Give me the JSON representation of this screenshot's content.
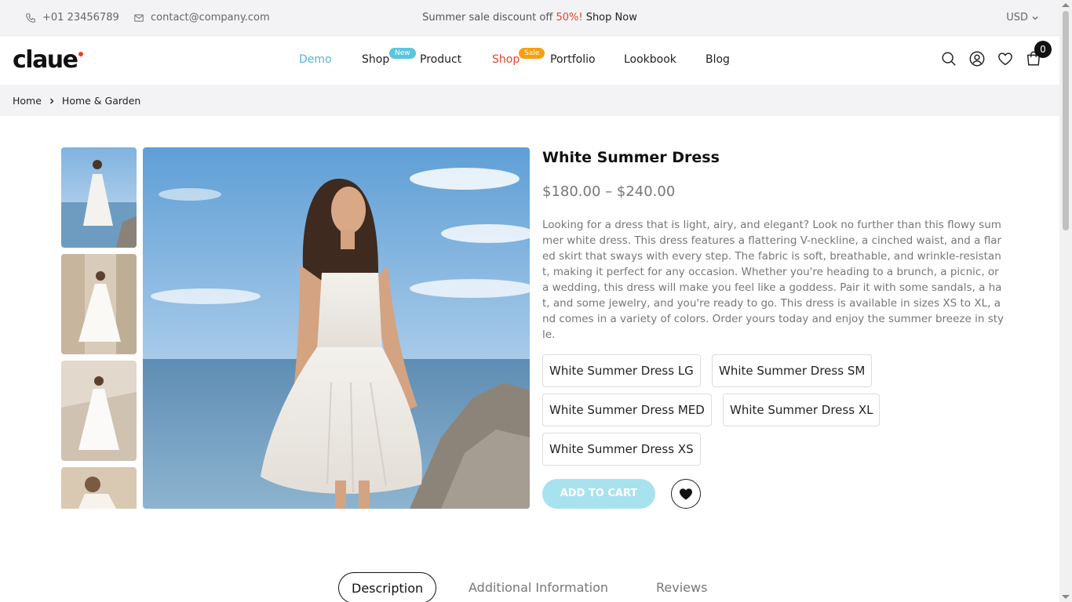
{
  "topbar": {
    "phone": "+01 23456789",
    "email": "contact@company.com",
    "promo_text": "Summer sale discount off ",
    "promo_pct": "50%!",
    "promo_cta": "Shop Now",
    "currency": "USD"
  },
  "header": {
    "logo": "claue",
    "nav": [
      {
        "label": "Demo"
      },
      {
        "label": "Shop",
        "badge": "New"
      },
      {
        "label": "Product"
      },
      {
        "label": "Shop",
        "badge": "Sale"
      },
      {
        "label": "Portfolio"
      },
      {
        "label": "Lookbook"
      },
      {
        "label": "Blog"
      }
    ],
    "cart_count": "0",
    "icons": [
      "search-icon",
      "user-icon",
      "heart-icon",
      "bag-icon"
    ]
  },
  "breadcrumb": [
    "Home",
    "Home & Garden"
  ],
  "product": {
    "title": "White Summer Dress",
    "price": "$180.00 – $240.00",
    "description": "Looking for a dress that is light, airy, and elegant? Look no further than this flowy summer white dress. This dress features a flattering V-neckline, a cinched waist, and a flared skirt that sways with every step. The fabric is soft, breathable, and wrinkle-resistant, making it perfect for any occasion. Whether you're heading to a brunch, a picnic, or a wedding, this dress will make you feel like a goddess. Pair it with some sandals, a hat, and some jewelry, and you're ready to go. This dress is available in sizes XS to XL, and comes in a variety of colors. Order yours today and enjoy the summer breeze in style.",
    "variants": [
      "White Summer Dress LG",
      "White Summer Dress SM",
      "White Summer Dress MED",
      "White Summer Dress XL",
      "White Summer Dress XS"
    ],
    "add_to_cart": "ADD TO CART"
  },
  "tabs": [
    "Description",
    "Additional Information",
    "Reviews"
  ],
  "colors": {
    "accent": "#4fb6d0",
    "sale": "#e2452b",
    "badge_new": "#5cc4dc",
    "badge_sale": "#f5a013",
    "add_to_cart_bg": "#a8e2ef"
  }
}
